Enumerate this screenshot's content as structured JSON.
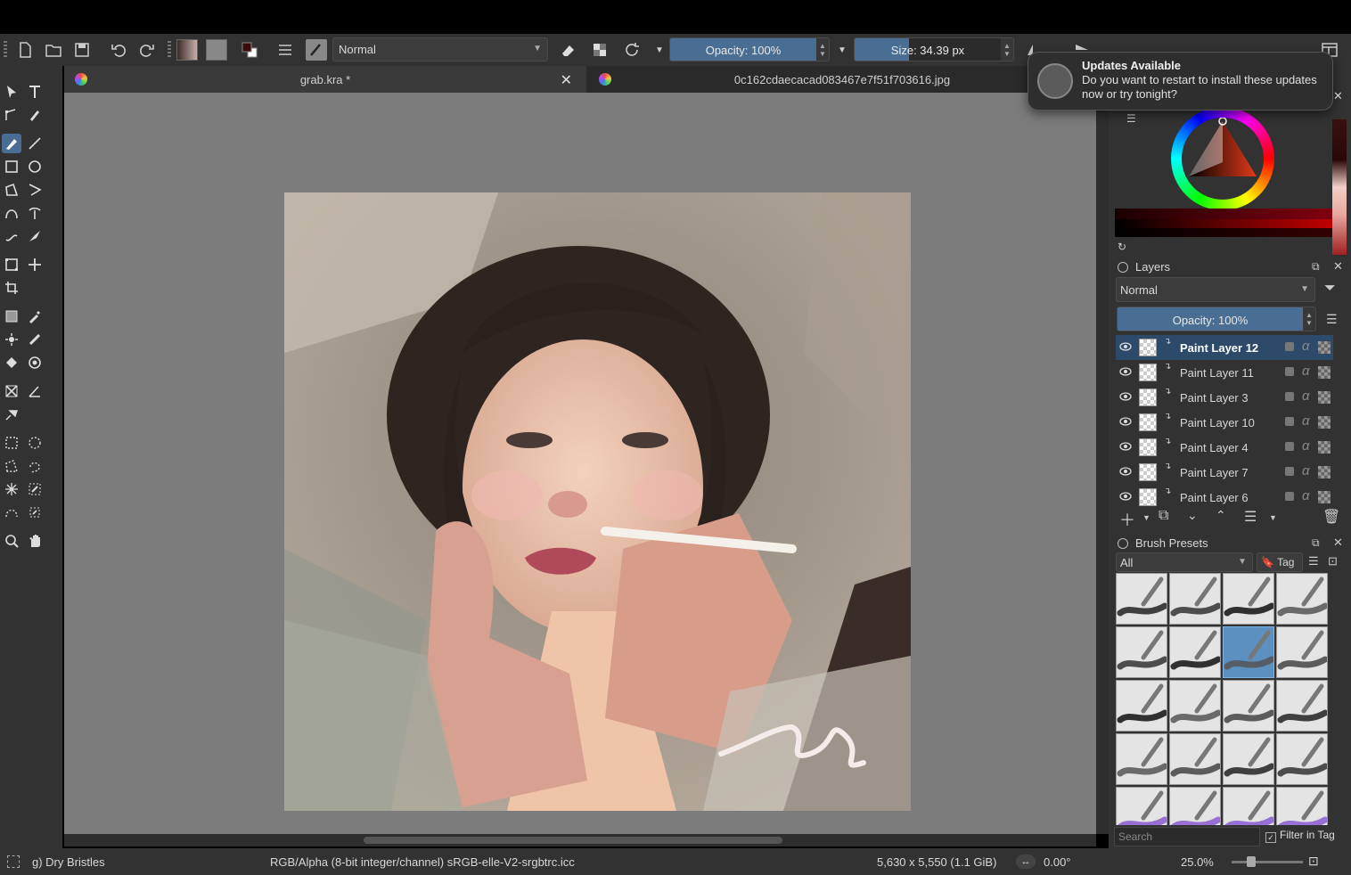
{
  "toolbar": {
    "blend_mode": "Normal",
    "opacity_label": "Opacity: 100%",
    "opacity_value": 1.0,
    "size_label": "Size: 34.39 px",
    "size_value": 0.34
  },
  "tabs": [
    {
      "title": "grab.kra *",
      "active": true
    },
    {
      "title": "0c162cdaecacad083467e7f51f703616.jpg",
      "active": false
    }
  ],
  "notification": {
    "title": "Updates Available",
    "body": "Do you want to restart to install these updates now or try tonight?"
  },
  "layers_panel": {
    "title": "Layers",
    "blend_mode": "Normal",
    "opacity_label": "Opacity:  100%",
    "opacity_value": 1.0,
    "layers": [
      {
        "name": "Paint Layer 12",
        "selected": true
      },
      {
        "name": "Paint Layer 11",
        "selected": false
      },
      {
        "name": "Paint Layer 3",
        "selected": false
      },
      {
        "name": "Paint Layer 10",
        "selected": false
      },
      {
        "name": "Paint Layer 4",
        "selected": false
      },
      {
        "name": "Paint Layer 7",
        "selected": false
      },
      {
        "name": "Paint Layer 6",
        "selected": false
      }
    ]
  },
  "brush_presets": {
    "title": "Brush Presets",
    "filter": "All",
    "tag_label": "Tag",
    "search_placeholder": "Search",
    "filter_in_tag": "Filter in Tag"
  },
  "status": {
    "brush_name": "g) Dry Bristles",
    "color_space": "RGB/Alpha (8-bit integer/channel)  sRGB-elle-V2-srgbtrc.icc",
    "image_size": "5,630 x 5,550 (1.1 GiB)",
    "rotation": "0.00°",
    "zoom": "25.0%"
  },
  "colors": {
    "accent": "#4a6d94",
    "selected_layer": "#2d4a6a",
    "canvas_bg": "#7c7c7c",
    "panel_bg": "#323232"
  }
}
